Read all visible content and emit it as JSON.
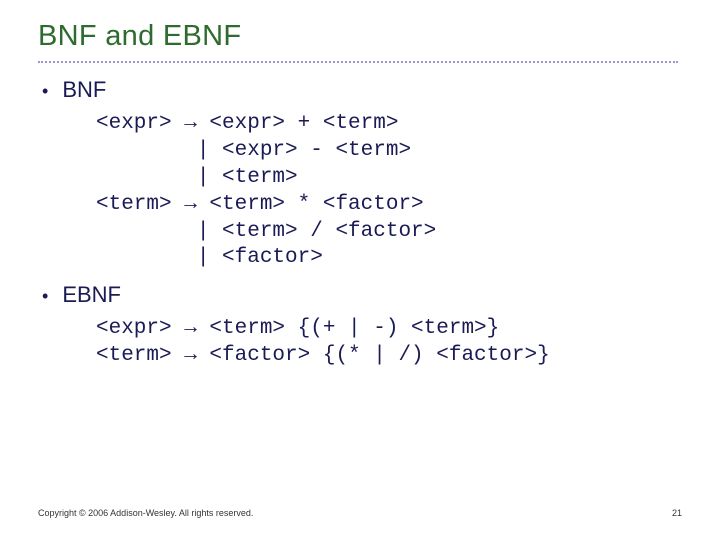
{
  "title": "BNF and EBNF",
  "sections": [
    {
      "label": "BNF",
      "code": "<expr> → <expr> + <term>\n        | <expr> - <term>\n        | <term>\n<term> → <term> * <factor>\n        | <term> / <factor>\n        | <factor>"
    },
    {
      "label": "EBNF",
      "code": "<expr> → <term> {(+ | -) <term>}\n<term> → <factor> {(* | /) <factor>}"
    }
  ],
  "footer": {
    "copyright": "Copyright © 2006 Addison-Wesley. All rights reserved.",
    "page": "21"
  }
}
